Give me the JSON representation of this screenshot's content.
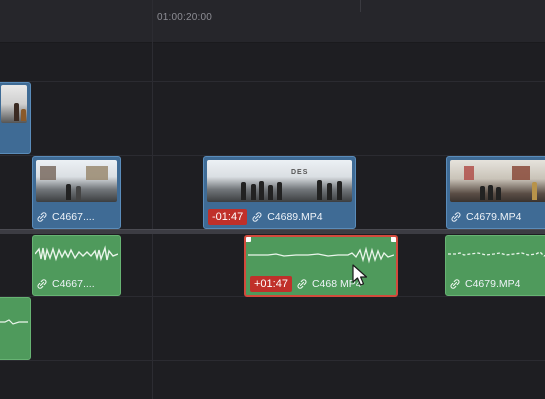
{
  "ruler": {
    "timecode": "01:00:20:00"
  },
  "clips": {
    "v_c4667": {
      "name": "C4667...."
    },
    "v_c4689": {
      "name": "C4689.MP4",
      "offset": "-01:47"
    },
    "v_c4679": {
      "name": "C4679.MP4"
    },
    "a_c4667": {
      "name": "C4667...."
    },
    "a_c4689": {
      "name": "C468 MP4",
      "offset": "+01:47"
    },
    "a_c4679": {
      "name": "C4679.MP4"
    }
  },
  "colors": {
    "video_clip": "#3f6b95",
    "audio_clip": "#4f9a5c",
    "offset_badge": "#c0302a",
    "selection_border": "#d24a3c"
  },
  "icons": [
    "link-icon",
    "trim-handle",
    "mouse-cursor-icon"
  ]
}
